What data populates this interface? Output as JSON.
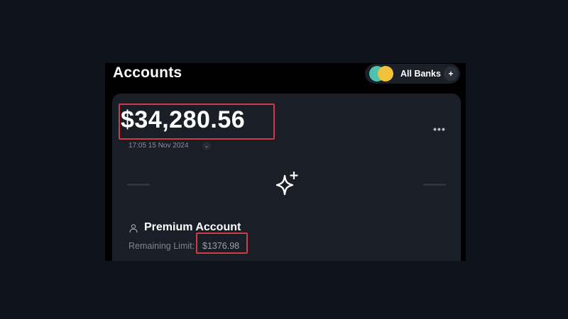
{
  "header": {
    "title": "Accounts",
    "banks_filter": {
      "label": "All Banks",
      "add_label": "+",
      "colors": [
        "#4fc2b0",
        "#f0c139"
      ]
    }
  },
  "balance_card": {
    "balance": "$34,280.56",
    "timestamp": "17:05 15 Nov 2024",
    "timestamp_toggle": "⌄",
    "more_label": "•••",
    "icon": "sparkle-icon"
  },
  "account": {
    "icon": "user-icon",
    "name": "Premium Account",
    "limit_label": "Remaining Limit:",
    "limit_value": "$1376.98"
  },
  "highlight_color": "#d23a44"
}
